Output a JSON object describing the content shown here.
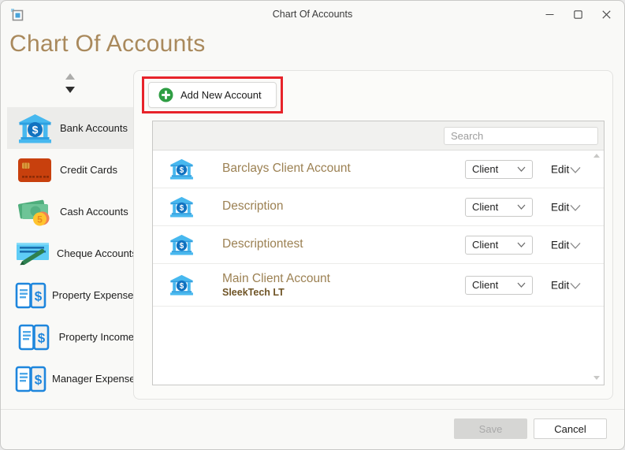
{
  "titlebar": {
    "title": "Chart Of Accounts",
    "controls": {
      "minimize": "minimize",
      "maximize": "maximize",
      "close": "close"
    }
  },
  "page": {
    "heading": "Chart Of Accounts"
  },
  "sidebar": {
    "scroll_up_icon": "triangle-up-icon",
    "scroll_down_icon": "triangle-down-icon",
    "items": [
      {
        "label": "Bank Accounts",
        "icon": "bank-icon",
        "selected": true
      },
      {
        "label": "Credit Cards",
        "icon": "credit-card-icon",
        "selected": false
      },
      {
        "label": "Cash Accounts",
        "icon": "cash-icon",
        "selected": false
      },
      {
        "label": "Cheque Accounts",
        "icon": "cheque-icon",
        "selected": false
      },
      {
        "label": "Property Expenses",
        "icon": "ledger-icon",
        "selected": false
      },
      {
        "label": "Property Income",
        "icon": "ledger-icon",
        "selected": false
      },
      {
        "label": "Manager Expenses",
        "icon": "ledger-icon",
        "selected": false
      }
    ]
  },
  "toolbar": {
    "add_button_label": "Add New Account",
    "add_icon": "plus-circle-icon"
  },
  "annotation": {
    "shape": "red-highlight-rectangle",
    "color": "#e7232a"
  },
  "search": {
    "placeholder": "Search"
  },
  "accounts": [
    {
      "name": "Barclays Client Account",
      "subtitle": "",
      "type_value": "Client",
      "edit_label": "Edit"
    },
    {
      "name": "Description",
      "subtitle": "",
      "type_value": "Client",
      "edit_label": "Edit"
    },
    {
      "name": "Descriptiontest",
      "subtitle": "",
      "type_value": "Client",
      "edit_label": "Edit"
    },
    {
      "name": "Main Client Account",
      "subtitle": "SleekTech LT",
      "type_value": "Client",
      "edit_label": "Edit"
    }
  ],
  "footer": {
    "save_label": "Save",
    "cancel_label": "Cancel"
  },
  "colors": {
    "heading_gold": "#a9895c",
    "account_name_gold": "#9c8153",
    "subtitle_brown": "#6f5426",
    "annotation_red": "#e7232a",
    "add_green": "#2f9e44",
    "bank_blue_light": "#47b8ef",
    "bank_blue_dark": "#1172c0",
    "save_disabled_bg": "#d6d6d4"
  }
}
